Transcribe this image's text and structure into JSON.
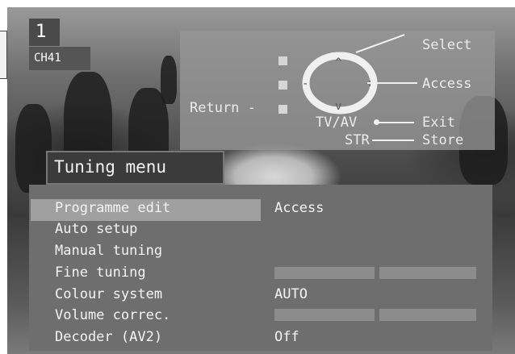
{
  "channel": {
    "number": "1",
    "name": "CH41"
  },
  "help": {
    "return_label": "Return -",
    "tvav_label": "TV/AV",
    "str_label": "STR",
    "select_label": "Select",
    "access_label": "Access",
    "exit_label": "Exit",
    "store_label": "Store",
    "up_arrow": "^",
    "down_arrow": "v",
    "minus_sign": "-",
    "plus_sign": "+"
  },
  "menu": {
    "title": "Tuning menu",
    "items": [
      {
        "label": "Programme edit",
        "value": "Access",
        "selected": true
      },
      {
        "label": "Auto setup",
        "value": ""
      },
      {
        "label": "Manual tuning",
        "value": ""
      },
      {
        "label": "Fine tuning",
        "value": ""
      },
      {
        "label": "Colour system",
        "value": "AUTO"
      },
      {
        "label": "Volume correc.",
        "value": ""
      },
      {
        "label": "Decoder (AV2)",
        "value": "Off"
      }
    ]
  },
  "icons": {
    "remote": "remote-control-dpad-icon"
  },
  "colors": {
    "panel": "#6e6e6e",
    "highlight": "#a0a0a0",
    "osd": "#4a4a4a"
  }
}
